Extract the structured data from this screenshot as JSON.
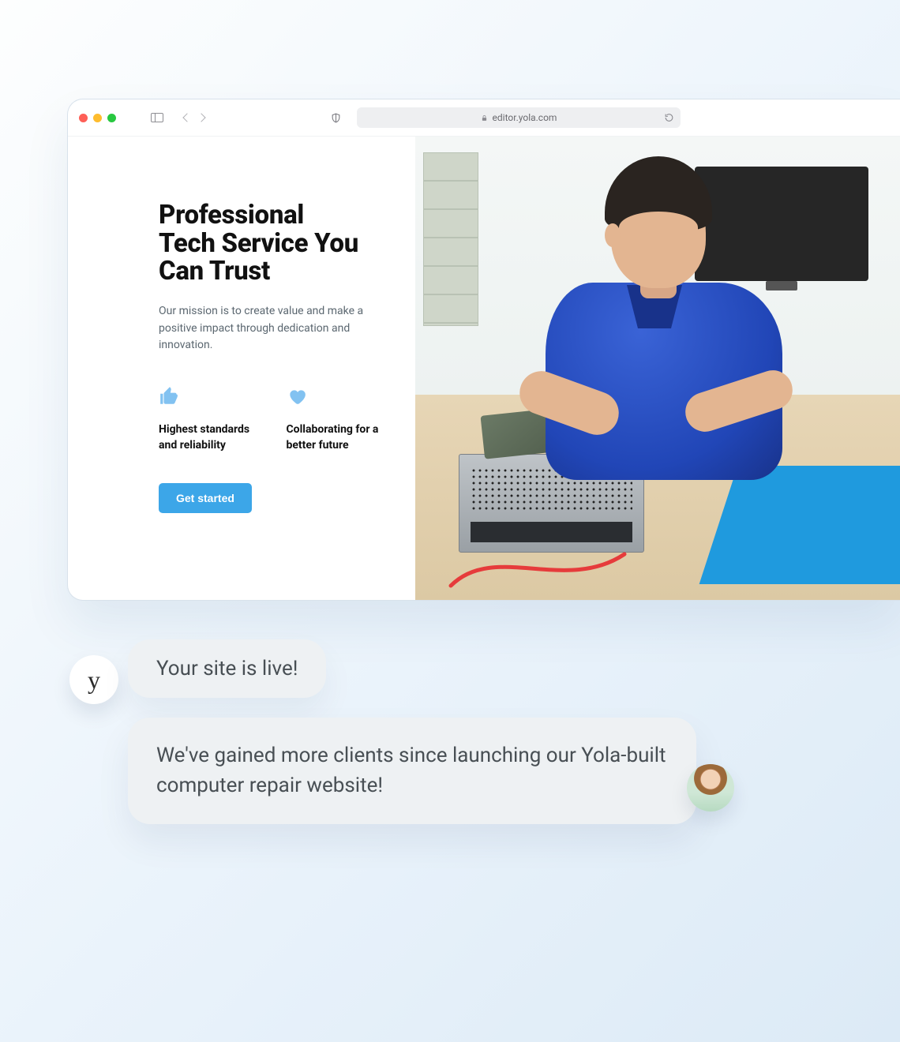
{
  "browser": {
    "url": "editor.yola.com"
  },
  "hero": {
    "title_line1": "Professional",
    "title_line2": "Tech Service You",
    "title_line3": "Can Trust",
    "subtitle": "Our mission is to create value and make a positive impact through dedication and innovation.",
    "feature1": "Highest standards and reliability",
    "feature2": "Collaborating for a better future",
    "cta": "Get started"
  },
  "chat": {
    "brand_glyph": "y",
    "bubble1": "Your site is live!",
    "bubble2": "We've gained more clients since launching our Yola-built computer repair website!"
  },
  "colors": {
    "accent": "#3ca6e8",
    "icon_accent": "#82c2f1"
  }
}
